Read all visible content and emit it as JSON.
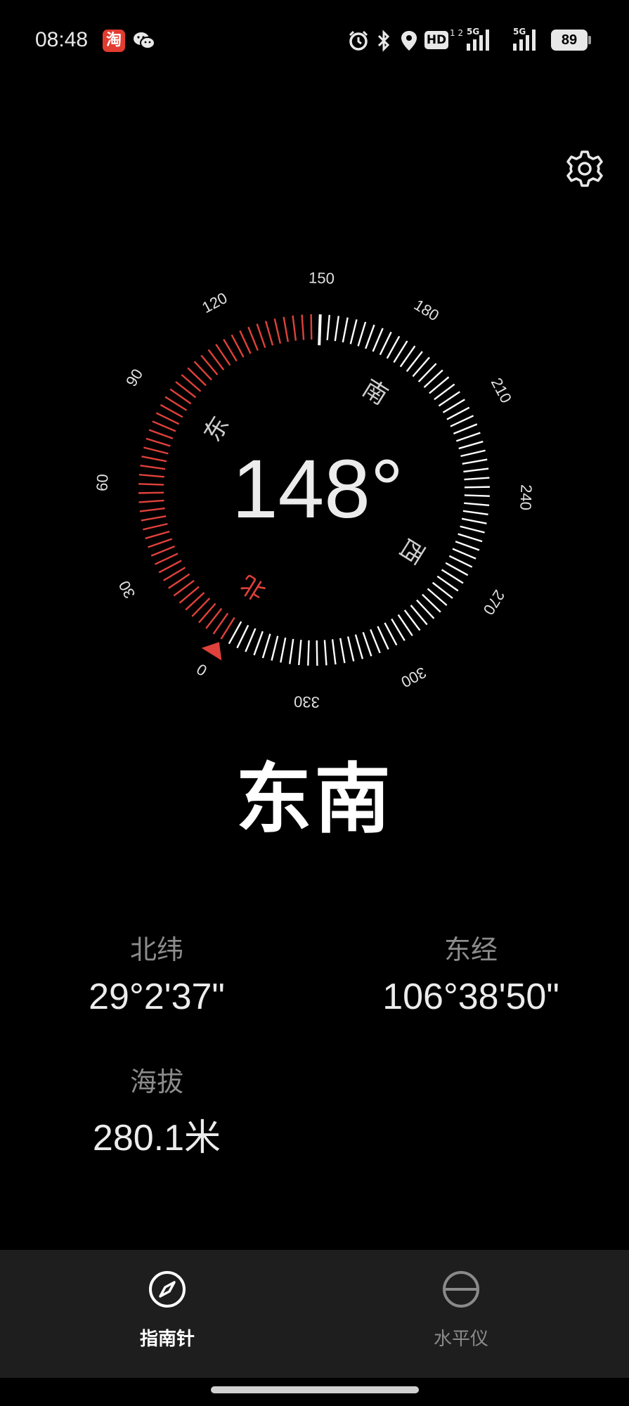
{
  "status_bar": {
    "time": "08:48",
    "taobao_char": "淘",
    "hd_label": "HD",
    "hd_sub": "1 2",
    "network_label_1": "5G",
    "network_label_2": "5G",
    "battery": "89",
    "icons": [
      "taobao-icon",
      "wechat-icon",
      "alarm-icon",
      "bluetooth-icon",
      "location-icon",
      "hd-icon",
      "signal-icon",
      "signal-icon",
      "battery-icon"
    ]
  },
  "compass": {
    "heading_display": "148°",
    "heading_degrees": 148,
    "scale_labels": [
      "150",
      "180",
      "210",
      "240",
      "270",
      "300",
      "330",
      "0",
      "30",
      "60",
      "90",
      "120"
    ],
    "cardinals": [
      "南",
      "西",
      "北",
      "东"
    ],
    "accent_color": "#e0413b"
  },
  "direction_name": "东南",
  "info": {
    "latitude_label": "北纬",
    "latitude_value": "29°2'37\"",
    "longitude_label": "东经",
    "longitude_value": "106°38'50\"",
    "altitude_label": "海拔",
    "altitude_value": "280.1米"
  },
  "tabs": [
    {
      "label": "指南针",
      "icon": "compass-icon",
      "active": true
    },
    {
      "label": "水平仪",
      "icon": "level-icon",
      "active": false
    }
  ]
}
